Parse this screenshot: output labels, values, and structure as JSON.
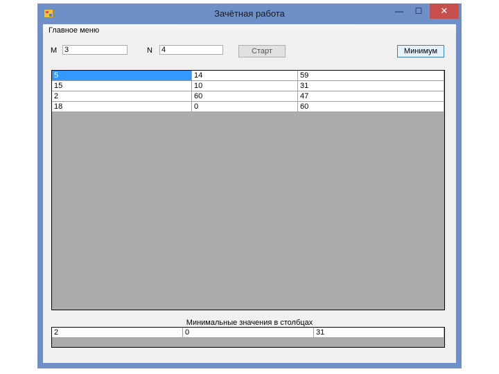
{
  "window": {
    "title": "Зачётная работа",
    "min_glyph": "—",
    "max_glyph": "☐",
    "close_glyph": "✕",
    "icon": "app-icon"
  },
  "menu": {
    "main": "Главное меню"
  },
  "inputs": {
    "m_label": "M",
    "m_value": "3",
    "n_label": "N",
    "n_value": "4"
  },
  "buttons": {
    "start": "Старт",
    "minimum": "Минимум"
  },
  "table1": {
    "rows": [
      [
        "5",
        "14",
        "59"
      ],
      [
        "15",
        "10",
        "31"
      ],
      [
        "2",
        "60",
        "47"
      ],
      [
        "18",
        "0",
        "60"
      ]
    ],
    "selected_cell": [
      0,
      0
    ]
  },
  "table2": {
    "title": "Минимальные значения в столбцах",
    "rows": [
      [
        "2",
        "0",
        "31"
      ]
    ]
  }
}
